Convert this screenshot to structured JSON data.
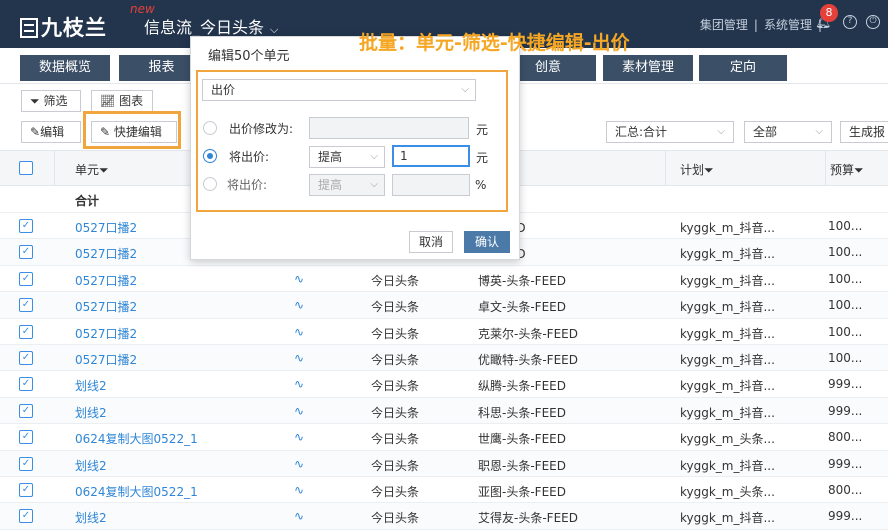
{
  "header": {
    "logo_text": "九枝兰",
    "new_badge": "new",
    "app_title": "信息流_今日头条",
    "links": [
      "集团管理",
      "系统管理"
    ],
    "notification_count": "8"
  },
  "nav": {
    "tabs": [
      "数据概览",
      "报表",
      "创意",
      "素材管理",
      "定向"
    ]
  },
  "toolbar": {
    "filter_label": "筛选",
    "chart_label": "图表",
    "edit_label": "编辑",
    "quick_edit_label": "快捷编辑",
    "summary_select": "汇总:合计",
    "scope_select": "全部",
    "generate_label": "生成报"
  },
  "annotation": "批量：单元-筛选-快捷编辑-出价",
  "modal": {
    "title": "编辑50个单元",
    "field_select": "出价",
    "option1_label": "出价修改为:",
    "option1_unit": "元",
    "option2_label": "将出价:",
    "option2_mode": "提高",
    "option2_value": "1",
    "option2_unit": "元",
    "option3_label": "将出价:",
    "option3_mode": "提高",
    "option3_unit": "%",
    "cancel_label": "取消",
    "confirm_label": "确认"
  },
  "table": {
    "headers": {
      "unit": "单元",
      "plan": "计划",
      "budget": "预算"
    },
    "summary_label": "合计",
    "rows": [
      {
        "unit": "0527口播2",
        "media": "",
        "account": "条-FEED",
        "plan": "kyggk_m_抖音...",
        "budget": "100..."
      },
      {
        "unit": "0527口播2",
        "media": "",
        "account": "条-FEED",
        "plan": "kyggk_m_抖音...",
        "budget": "100..."
      },
      {
        "unit": "0527口播2",
        "media": "今日头条",
        "account": "博英-头条-FEED",
        "plan": "kyggk_m_抖音...",
        "budget": "100..."
      },
      {
        "unit": "0527口播2",
        "media": "今日头条",
        "account": "卓文-头条-FEED",
        "plan": "kyggk_m_抖音...",
        "budget": "100..."
      },
      {
        "unit": "0527口播2",
        "media": "今日头条",
        "account": "克莱尔-头条-FEED",
        "plan": "kyggk_m_抖音...",
        "budget": "100..."
      },
      {
        "unit": "0527口播2",
        "media": "今日头条",
        "account": "优瞰特-头条-FEED",
        "plan": "kyggk_m_抖音...",
        "budget": "100..."
      },
      {
        "unit": "划线2",
        "media": "今日头条",
        "account": "纵腾-头条-FEED",
        "plan": "kyggk_m_抖音...",
        "budget": "999..."
      },
      {
        "unit": "划线2",
        "media": "今日头条",
        "account": "科思-头条-FEED",
        "plan": "kyggk_m_抖音...",
        "budget": "999..."
      },
      {
        "unit": "0624复制大图0522_1",
        "media": "今日头条",
        "account": "世鹰-头条-FEED",
        "plan": "kyggk_m_头条...",
        "budget": "800..."
      },
      {
        "unit": "划线2",
        "media": "今日头条",
        "account": "职恩-头条-FEED",
        "plan": "kyggk_m_抖音...",
        "budget": "999..."
      },
      {
        "unit": "0624复制大图0522_1",
        "media": "今日头条",
        "account": "亚图-头条-FEED",
        "plan": "kyggk_m_头条...",
        "budget": "800..."
      },
      {
        "unit": "划线2",
        "media": "今日头条",
        "account": "艾得友-头条-FEED",
        "plan": "kyggk_m_抖音...",
        "budget": "999..."
      }
    ]
  }
}
